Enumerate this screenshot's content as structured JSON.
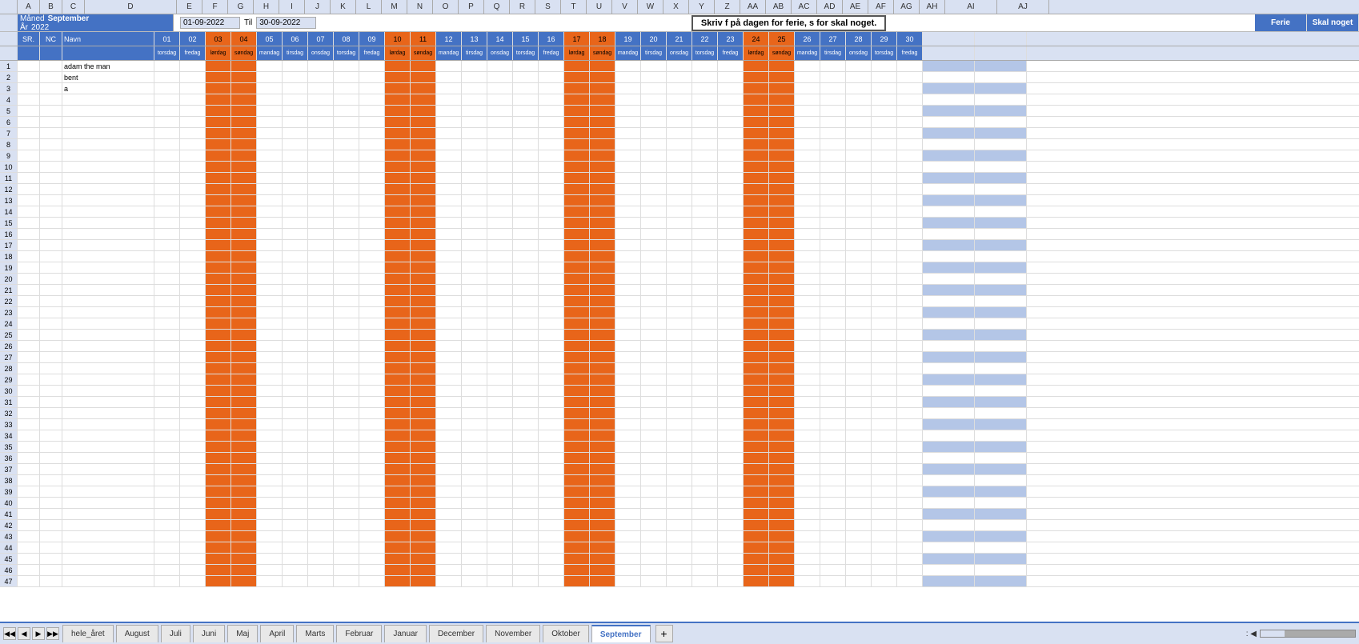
{
  "header": {
    "month_label": "Måned",
    "month_value": "September",
    "year_label": "År",
    "year_value": "2022",
    "from_date": "01-09-2022",
    "til_label": "Til",
    "to_date": "30-09-2022",
    "instruction": "Skriv f på dagen for ferie, s for skal noget."
  },
  "column_headers": {
    "sr": "SR.",
    "nc": "NC",
    "name": "Navn",
    "ferie": "Ferie",
    "skal_noget": "Skal noget"
  },
  "days": [
    {
      "num": "01",
      "name": "torsdag",
      "weekend": false
    },
    {
      "num": "02",
      "name": "fredag",
      "weekend": false
    },
    {
      "num": "03",
      "name": "lørdag",
      "weekend": true
    },
    {
      "num": "04",
      "name": "søndag",
      "weekend": true
    },
    {
      "num": "05",
      "name": "mandag",
      "weekend": false
    },
    {
      "num": "06",
      "name": "tirsdag",
      "weekend": false
    },
    {
      "num": "07",
      "name": "onsdag",
      "weekend": false
    },
    {
      "num": "08",
      "name": "torsdag",
      "weekend": false
    },
    {
      "num": "09",
      "name": "fredag",
      "weekend": false
    },
    {
      "num": "10",
      "name": "lørdag",
      "weekend": true
    },
    {
      "num": "11",
      "name": "søndag",
      "weekend": true
    },
    {
      "num": "12",
      "name": "mandag",
      "weekend": false
    },
    {
      "num": "13",
      "name": "tirsdag",
      "weekend": false
    },
    {
      "num": "14",
      "name": "onsdag",
      "weekend": false
    },
    {
      "num": "15",
      "name": "torsdag",
      "weekend": false
    },
    {
      "num": "16",
      "name": "fredag",
      "weekend": false
    },
    {
      "num": "17",
      "name": "lørdag",
      "weekend": true
    },
    {
      "num": "18",
      "name": "søndag",
      "weekend": true
    },
    {
      "num": "19",
      "name": "mandag",
      "weekend": false
    },
    {
      "num": "20",
      "name": "tirsdag",
      "weekend": false
    },
    {
      "num": "21",
      "name": "onsdag",
      "weekend": false
    },
    {
      "num": "22",
      "name": "torsdag",
      "weekend": false
    },
    {
      "num": "23",
      "name": "fredag",
      "weekend": false
    },
    {
      "num": "24",
      "name": "lørdag",
      "weekend": true
    },
    {
      "num": "25",
      "name": "søndag",
      "weekend": true
    },
    {
      "num": "26",
      "name": "mandag",
      "weekend": false
    },
    {
      "num": "27",
      "name": "tirsdag",
      "weekend": false
    },
    {
      "num": "28",
      "name": "onsdag",
      "weekend": false
    },
    {
      "num": "29",
      "name": "torsdag",
      "weekend": false
    },
    {
      "num": "30",
      "name": "fredag",
      "weekend": false
    }
  ],
  "data_rows": [
    {
      "row": "1",
      "sr": "",
      "nc": "",
      "name": "adam the man"
    },
    {
      "row": "2",
      "sr": "",
      "nc": "",
      "name": "bent"
    },
    {
      "row": "3",
      "sr": "",
      "nc": "",
      "name": "a"
    },
    {
      "row": "4",
      "sr": "",
      "nc": "",
      "name": ""
    },
    {
      "row": "5",
      "sr": "",
      "nc": "",
      "name": ""
    },
    {
      "row": "6",
      "sr": "",
      "nc": "",
      "name": ""
    },
    {
      "row": "7",
      "sr": "",
      "nc": "",
      "name": ""
    },
    {
      "row": "8",
      "sr": "",
      "nc": "",
      "name": ""
    },
    {
      "row": "9",
      "sr": "",
      "nc": "",
      "name": ""
    },
    {
      "row": "10",
      "sr": "",
      "nc": "",
      "name": ""
    },
    {
      "row": "11",
      "sr": "",
      "nc": "",
      "name": ""
    },
    {
      "row": "12",
      "sr": "",
      "nc": "",
      "name": ""
    },
    {
      "row": "13",
      "sr": "",
      "nc": "",
      "name": ""
    },
    {
      "row": "14",
      "sr": "",
      "nc": "",
      "name": ""
    },
    {
      "row": "15",
      "sr": "",
      "nc": "",
      "name": ""
    },
    {
      "row": "16",
      "sr": "",
      "nc": "",
      "name": ""
    },
    {
      "row": "17",
      "sr": "",
      "nc": "",
      "name": ""
    },
    {
      "row": "18",
      "sr": "",
      "nc": "",
      "name": ""
    },
    {
      "row": "19",
      "sr": "",
      "nc": "",
      "name": ""
    },
    {
      "row": "20",
      "sr": "",
      "nc": "",
      "name": ""
    },
    {
      "row": "21",
      "sr": "",
      "nc": "",
      "name": ""
    },
    {
      "row": "22",
      "sr": "",
      "nc": "",
      "name": ""
    },
    {
      "row": "23",
      "sr": "",
      "nc": "",
      "name": ""
    },
    {
      "row": "24",
      "sr": "",
      "nc": "",
      "name": ""
    },
    {
      "row": "25",
      "sr": "",
      "nc": "",
      "name": ""
    },
    {
      "row": "26",
      "sr": "",
      "nc": "",
      "name": ""
    },
    {
      "row": "27",
      "sr": "",
      "nc": "",
      "name": ""
    },
    {
      "row": "28",
      "sr": "",
      "nc": "",
      "name": ""
    },
    {
      "row": "29",
      "sr": "",
      "nc": "",
      "name": ""
    },
    {
      "row": "30",
      "sr": "",
      "nc": "",
      "name": ""
    },
    {
      "row": "31",
      "sr": "",
      "nc": "",
      "name": ""
    },
    {
      "row": "32",
      "sr": "",
      "nc": "",
      "name": ""
    },
    {
      "row": "33",
      "sr": "",
      "nc": "",
      "name": ""
    },
    {
      "row": "34",
      "sr": "",
      "nc": "",
      "name": ""
    },
    {
      "row": "35",
      "sr": "",
      "nc": "",
      "name": ""
    },
    {
      "row": "36",
      "sr": "",
      "nc": "",
      "name": ""
    },
    {
      "row": "37",
      "sr": "",
      "nc": "",
      "name": ""
    },
    {
      "row": "38",
      "sr": "",
      "nc": "",
      "name": ""
    },
    {
      "row": "39",
      "sr": "",
      "nc": "",
      "name": ""
    },
    {
      "row": "40",
      "sr": "",
      "nc": "",
      "name": ""
    },
    {
      "row": "41",
      "sr": "",
      "nc": "",
      "name": ""
    },
    {
      "row": "42",
      "sr": "",
      "nc": "",
      "name": ""
    },
    {
      "row": "43",
      "sr": "",
      "nc": "",
      "name": ""
    },
    {
      "row": "44",
      "sr": "",
      "nc": "",
      "name": ""
    },
    {
      "row": "45",
      "sr": "",
      "nc": "",
      "name": ""
    },
    {
      "row": "46",
      "sr": "",
      "nc": "",
      "name": ""
    },
    {
      "row": "47",
      "sr": "",
      "nc": "",
      "name": ""
    }
  ],
  "tabs": [
    {
      "label": "hele_året",
      "active": false
    },
    {
      "label": "August",
      "active": false
    },
    {
      "label": "Juli",
      "active": false
    },
    {
      "label": "Juni",
      "active": false
    },
    {
      "label": "Maj",
      "active": false
    },
    {
      "label": "April",
      "active": false
    },
    {
      "label": "Marts",
      "active": false
    },
    {
      "label": "Februar",
      "active": false
    },
    {
      "label": "Januar",
      "active": false
    },
    {
      "label": "December",
      "active": false
    },
    {
      "label": "November",
      "active": false
    },
    {
      "label": "Oktober",
      "active": false
    },
    {
      "label": "September",
      "active": true
    }
  ],
  "colors": {
    "orange": "#E8651A",
    "blue_header": "#4472C4",
    "light_blue": "#B4C6E7",
    "row_num_bg": "#D9E1F2",
    "active_tab": "#4472C4"
  }
}
